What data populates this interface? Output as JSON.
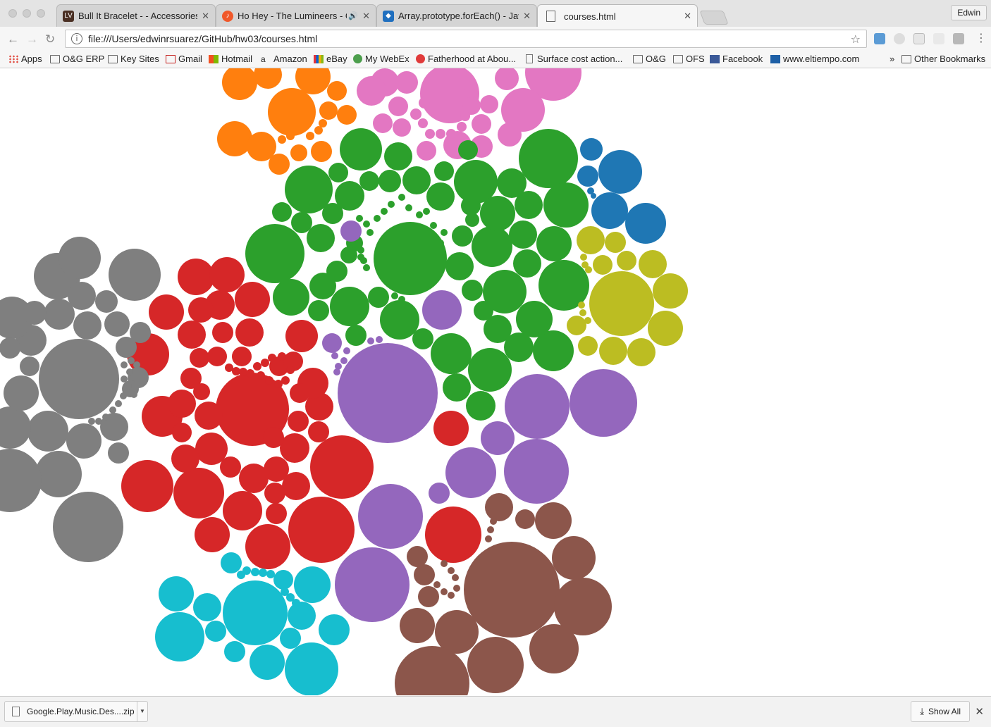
{
  "window": {
    "profile_name": "Edwin"
  },
  "tabs": [
    {
      "label": "Bull It Bracelet - - Accessories",
      "favicon": "louis-vuitton-icon",
      "color": "#4a2f23",
      "active": false
    },
    {
      "label": "Ho Hey - The Lumineers - G",
      "favicon": "music-icon",
      "color": "#f0582a",
      "active": false,
      "audio": true
    },
    {
      "label": "Array.prototype.forEach() - Jav",
      "favicon": "mdn-icon",
      "color": "#1f6fbf",
      "active": false
    },
    {
      "label": "courses.html",
      "favicon": "page-icon",
      "color": "#ffffff",
      "active": true
    }
  ],
  "toolbar": {
    "url": "file:///Users/edwinrsuarez/GitHub/hw03/courses.html",
    "back_icon": "back-arrow-icon",
    "forward_icon": "forward-arrow-icon",
    "reload_icon": "reload-icon"
  },
  "bookmarks": [
    {
      "label": "Apps",
      "icon": "apps-grid-icon"
    },
    {
      "label": "O&G ERP",
      "icon": "folder-icon"
    },
    {
      "label": "Key Sites",
      "icon": "folder-icon"
    },
    {
      "label": "Gmail",
      "icon": "gmail-icon"
    },
    {
      "label": "Hotmail",
      "icon": "microsoft-icon"
    },
    {
      "label": "Amazon",
      "icon": "amazon-icon"
    },
    {
      "label": "eBay",
      "icon": "ebay-icon"
    },
    {
      "label": "My WebEx",
      "icon": "webex-icon"
    },
    {
      "label": "Fatherhood at Abou...",
      "icon": "about-icon"
    },
    {
      "label": "Surface cost action...",
      "icon": "page-icon"
    },
    {
      "label": "O&G",
      "icon": "folder-icon"
    },
    {
      "label": "OFS",
      "icon": "folder-icon"
    },
    {
      "label": "Facebook",
      "icon": "facebook-icon"
    },
    {
      "label": "www.eltiempo.com",
      "icon": "eltiempo-icon"
    }
  ],
  "bookmarks_overflow": "»",
  "other_bookmarks": "Other Bookmarks",
  "download_bar": {
    "file_name": "Google.Play.Music.Des....zip",
    "show_all": "Show All"
  },
  "colors": {
    "orange": "#ff7f0e",
    "pink": "#e377c2",
    "green": "#2ca02c",
    "blue": "#1f77b4",
    "olive": "#bcbd22",
    "purple": "#9467bd",
    "red": "#d62728",
    "gray": "#7f7f7f",
    "cyan": "#17becf",
    "brown": "#8c564b"
  }
}
